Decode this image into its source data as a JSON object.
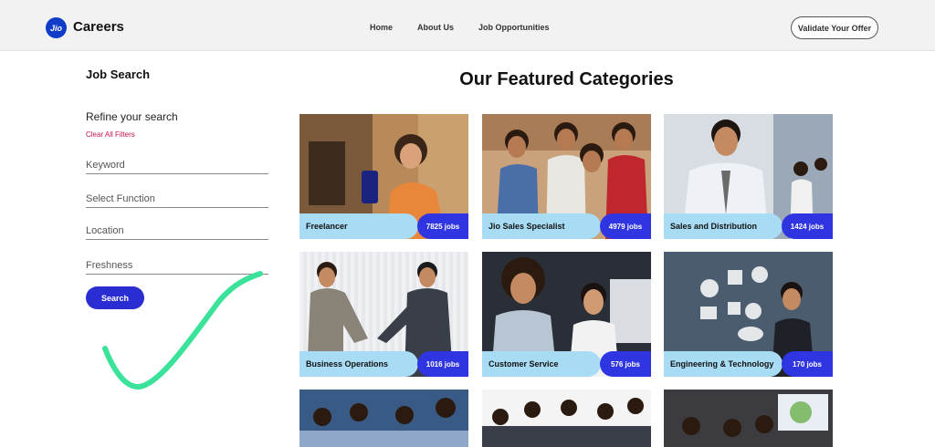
{
  "header": {
    "logo_text": "Jio",
    "brand": "Careers",
    "nav": [
      "Home",
      "About Us",
      "Job Opportunities"
    ],
    "cta": "Validate Your Offer"
  },
  "sidebar": {
    "title": "Job Search",
    "refine": "Refine your search",
    "clear": "Clear All Filters",
    "fields": [
      "Keyword",
      "Select Function",
      "Location",
      "Freshness"
    ],
    "search_button": "Search"
  },
  "main": {
    "title": "Our Featured Categories",
    "categories": [
      {
        "label": "Freelancer",
        "count": "7825 jobs"
      },
      {
        "label": "Jio Sales Specialist",
        "count": "4979 jobs"
      },
      {
        "label": "Sales and Distribution",
        "count": "1424 jobs"
      },
      {
        "label": "Business Operations",
        "count": "1016 jobs"
      },
      {
        "label": "Customer Service",
        "count": "576 jobs"
      },
      {
        "label": "Engineering & Technology",
        "count": "170 jobs"
      }
    ]
  },
  "colors": {
    "accent": "#2f35e0",
    "label_bg": "#a8dcf5",
    "clear_link": "#c0144c",
    "checkmark": "#3be39a"
  }
}
